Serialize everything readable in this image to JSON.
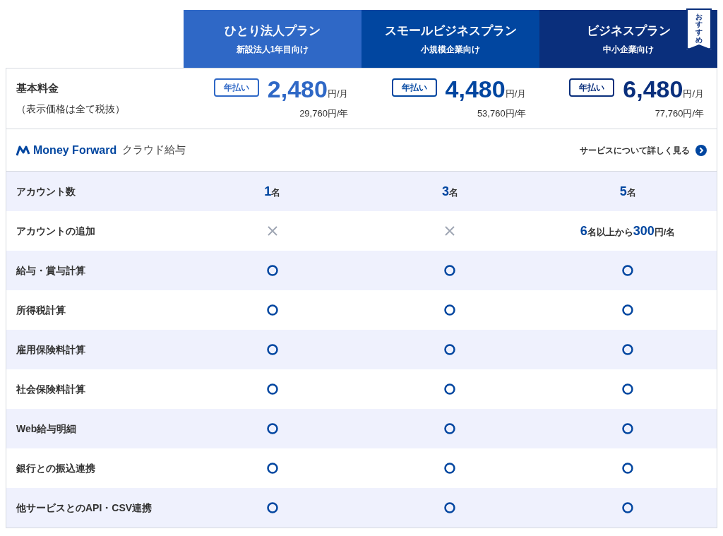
{
  "plans": [
    {
      "name": "ひとり法人プラン",
      "target": "新設法人1年目向け",
      "color": "#2f68c6",
      "recommended": false,
      "badge": "年払い",
      "price": "2,480",
      "unit": "円/月",
      "yearly": "29,760円/年"
    },
    {
      "name": "スモールビジネスプラン",
      "target": "小規模企業向け",
      "color": "#0146a0",
      "recommended": false,
      "badge": "年払い",
      "price": "4,480",
      "unit": "円/月",
      "yearly": "53,760円/年"
    },
    {
      "name": "ビジネスプラン",
      "target": "中小企業向け",
      "color": "#0a2f7c",
      "recommended": true,
      "ribbon": "おすすめ",
      "badge": "年払い",
      "price": "6,480",
      "unit": "円/月",
      "yearly": "77,760円/年"
    }
  ],
  "price_label": {
    "title": "基本料金",
    "note": "（表示価格は全て税抜）"
  },
  "product": {
    "brand": "Money Forward",
    "name": "クラウド給与",
    "link": "サービスについて詳しく見る"
  },
  "rows": [
    {
      "label": "アカウント数",
      "cells": [
        {
          "kind": "text",
          "text": "**1**名"
        },
        {
          "kind": "text",
          "text": "**3**名"
        },
        {
          "kind": "text",
          "text": "**5**名"
        }
      ]
    },
    {
      "label": "アカウントの追加",
      "cells": [
        {
          "kind": "cross"
        },
        {
          "kind": "cross"
        },
        {
          "kind": "text",
          "text": "**6**名以上から**300**円/名"
        }
      ]
    },
    {
      "label": "給与・賞与計算",
      "cells": [
        {
          "kind": "circle"
        },
        {
          "kind": "circle"
        },
        {
          "kind": "circle"
        }
      ]
    },
    {
      "label": "所得税計算",
      "cells": [
        {
          "kind": "circle"
        },
        {
          "kind": "circle"
        },
        {
          "kind": "circle"
        }
      ]
    },
    {
      "label": "雇用保険料計算",
      "cells": [
        {
          "kind": "circle"
        },
        {
          "kind": "circle"
        },
        {
          "kind": "circle"
        }
      ]
    },
    {
      "label": "社会保険料計算",
      "cells": [
        {
          "kind": "circle"
        },
        {
          "kind": "circle"
        },
        {
          "kind": "circle"
        }
      ]
    },
    {
      "label": "Web給与明細",
      "cells": [
        {
          "kind": "circle"
        },
        {
          "kind": "circle"
        },
        {
          "kind": "circle"
        }
      ]
    },
    {
      "label": "銀行との振込連携",
      "cells": [
        {
          "kind": "circle"
        },
        {
          "kind": "circle"
        },
        {
          "kind": "circle"
        }
      ]
    },
    {
      "label": "他サービスとのAPI・CSV連携",
      "cells": [
        {
          "kind": "circle"
        },
        {
          "kind": "circle"
        },
        {
          "kind": "circle"
        }
      ]
    }
  ]
}
